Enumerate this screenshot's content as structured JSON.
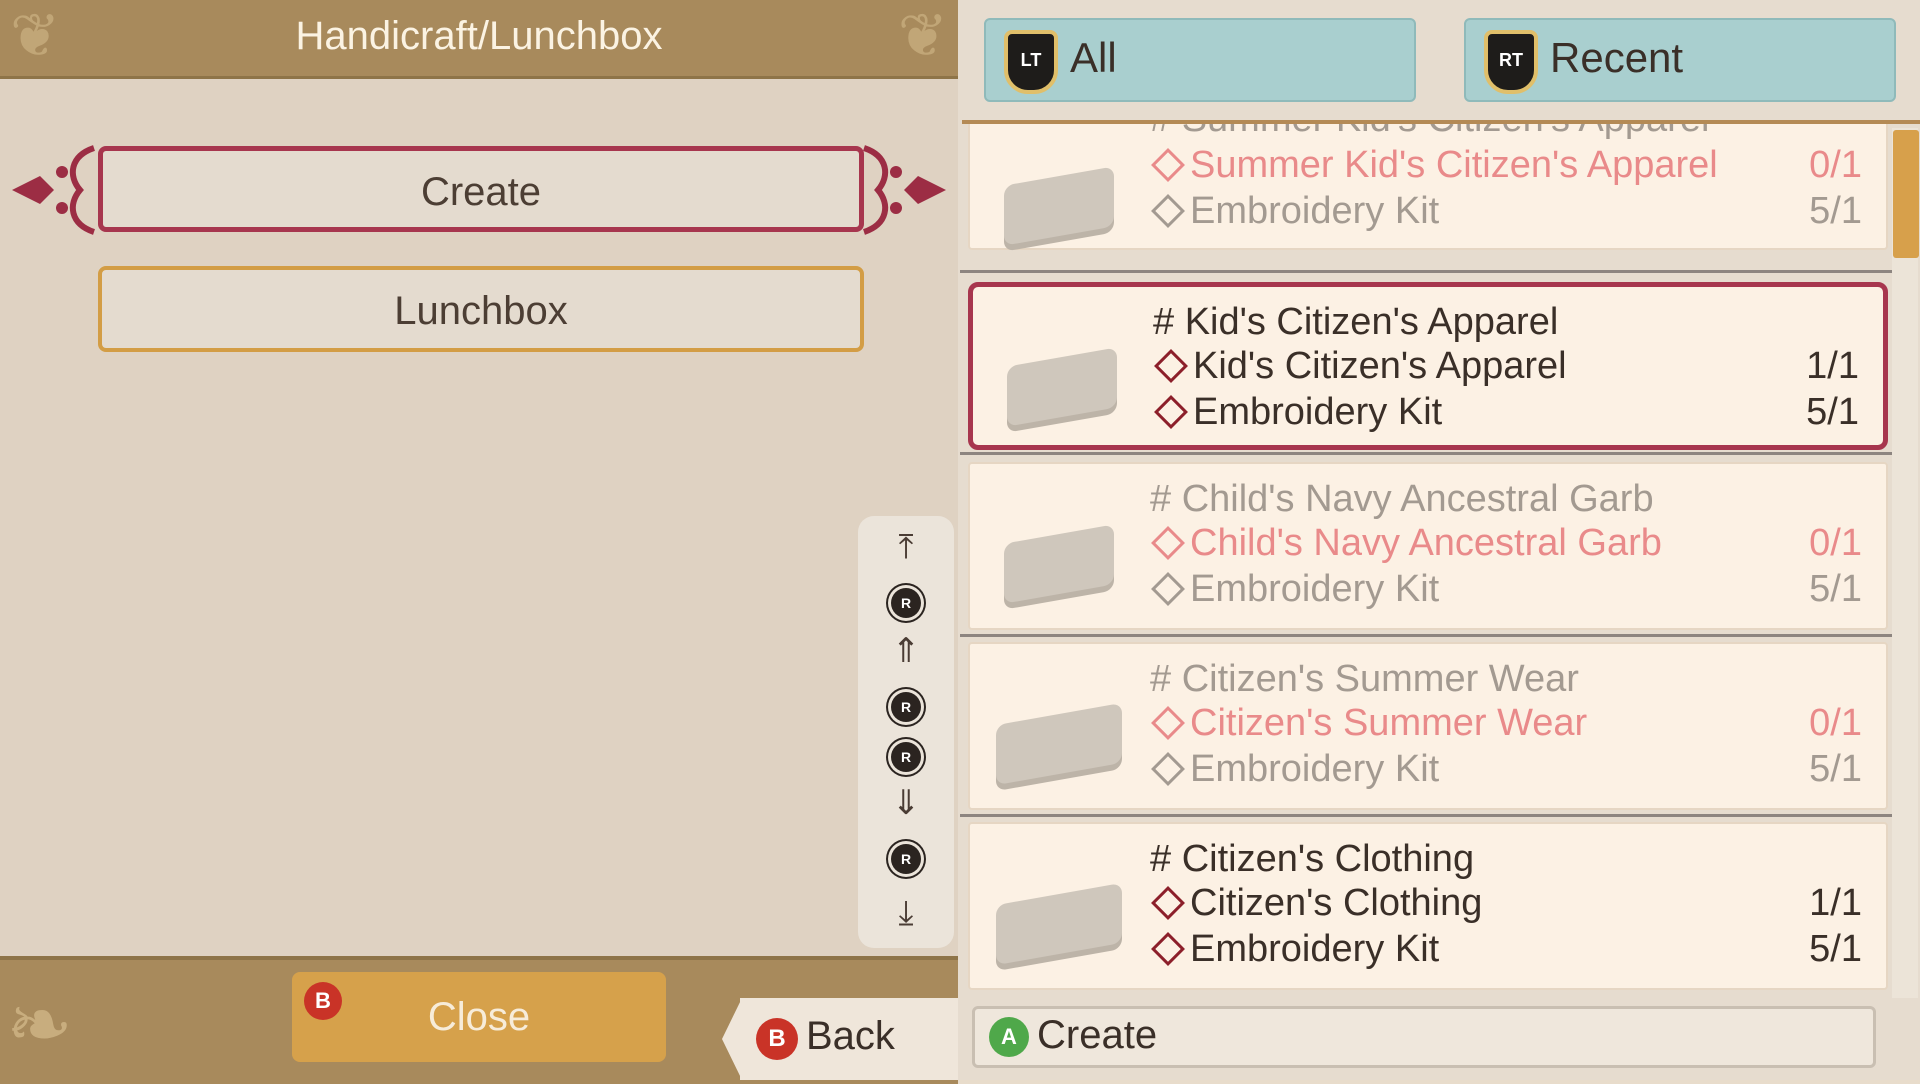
{
  "header": {
    "title": "Handicraft/Lunchbox"
  },
  "menu": {
    "items": [
      {
        "label": "Create",
        "selected": true
      },
      {
        "label": "Lunchbox",
        "selected": false
      }
    ]
  },
  "scroll_guide": {
    "button": "R"
  },
  "footer": {
    "close_label": "Close",
    "close_button": "B",
    "back_label": "Back",
    "back_button": "B"
  },
  "tabs": [
    {
      "button": "LT",
      "label": "All"
    },
    {
      "button": "RT",
      "label": "Recent"
    }
  ],
  "recipes": [
    {
      "title": "# Summer Kid's Citizen's Apparel",
      "craftable": false,
      "materials": [
        {
          "name": "Summer Kid's Citizen's Apparel",
          "qty": "0/1"
        },
        {
          "name": "Embroidery Kit",
          "qty": "5/1"
        }
      ]
    },
    {
      "title": "# Kid's Citizen's Apparel",
      "craftable": true,
      "selected": true,
      "materials": [
        {
          "name": "Kid's Citizen's Apparel",
          "qty": "1/1"
        },
        {
          "name": "Embroidery Kit",
          "qty": "5/1"
        }
      ]
    },
    {
      "title": "# Child's Navy Ancestral Garb",
      "craftable": false,
      "materials": [
        {
          "name": "Child's Navy Ancestral Garb",
          "qty": "0/1"
        },
        {
          "name": "Embroidery Kit",
          "qty": "5/1"
        }
      ]
    },
    {
      "title": "# Citizen's Summer Wear",
      "craftable": false,
      "materials": [
        {
          "name": "Citizen's Summer Wear",
          "qty": "0/1"
        },
        {
          "name": "Embroidery Kit",
          "qty": "5/1"
        }
      ]
    },
    {
      "title": "# Citizen's Clothing",
      "craftable": true,
      "materials": [
        {
          "name": "Citizen's Clothing",
          "qty": "1/1"
        },
        {
          "name": "Embroidery Kit",
          "qty": "5/1"
        }
      ]
    }
  ],
  "action": {
    "button": "A",
    "label": "Create"
  },
  "colors": {
    "accent_selected": "#a7364e",
    "accent_gold": "#d39d45",
    "tab_teal": "#a9cfcf",
    "missing_pink": "#e98a8a"
  }
}
